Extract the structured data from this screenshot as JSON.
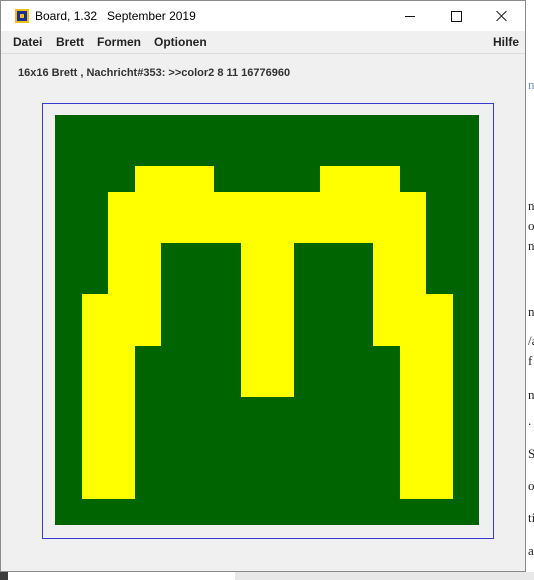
{
  "window": {
    "title": "Board, 1.32   September 2019",
    "icon": "board-app-icon",
    "controls": [
      "minimize-icon",
      "maximize-icon",
      "close-icon"
    ]
  },
  "menu": {
    "datei": "Datei",
    "brett": "Brett",
    "formen": "Formen",
    "optionen": "Optionen",
    "hilfe": "Hilfe"
  },
  "status": {
    "text": "16x16 Brett , Nachricht#353: >>color2 8 11 16776960"
  },
  "board": {
    "size": 16,
    "background_color": "#006400",
    "fill_color": "#ffff00",
    "grid_shown": false,
    "yellow_cells_by_row": [
      [],
      [],
      [
        3,
        4,
        5,
        10,
        11,
        12
      ],
      [
        2,
        3,
        4,
        5,
        6,
        7,
        8,
        9,
        10,
        11,
        12,
        13
      ],
      [
        2,
        3,
        4,
        5,
        6,
        7,
        8,
        9,
        10,
        11,
        12,
        13
      ],
      [
        2,
        3,
        7,
        8,
        12,
        13
      ],
      [
        2,
        3,
        7,
        8,
        12,
        13
      ],
      [
        1,
        2,
        3,
        7,
        8,
        12,
        13,
        14
      ],
      [
        1,
        2,
        3,
        7,
        8,
        12,
        13,
        14
      ],
      [
        1,
        2,
        7,
        8,
        13,
        14
      ],
      [
        1,
        2,
        7,
        8,
        13,
        14
      ],
      [
        1,
        2,
        13,
        14
      ],
      [
        1,
        2,
        13,
        14
      ],
      [
        1,
        2,
        13,
        14
      ],
      [
        1,
        2,
        13,
        14
      ],
      []
    ]
  },
  "background_page": {
    "glyphs": [
      "ne",
      "n",
      "o",
      "n",
      "n",
      "/a",
      "f",
      "n",
      ".",
      "Si",
      "ol",
      "ti",
      "at"
    ]
  }
}
